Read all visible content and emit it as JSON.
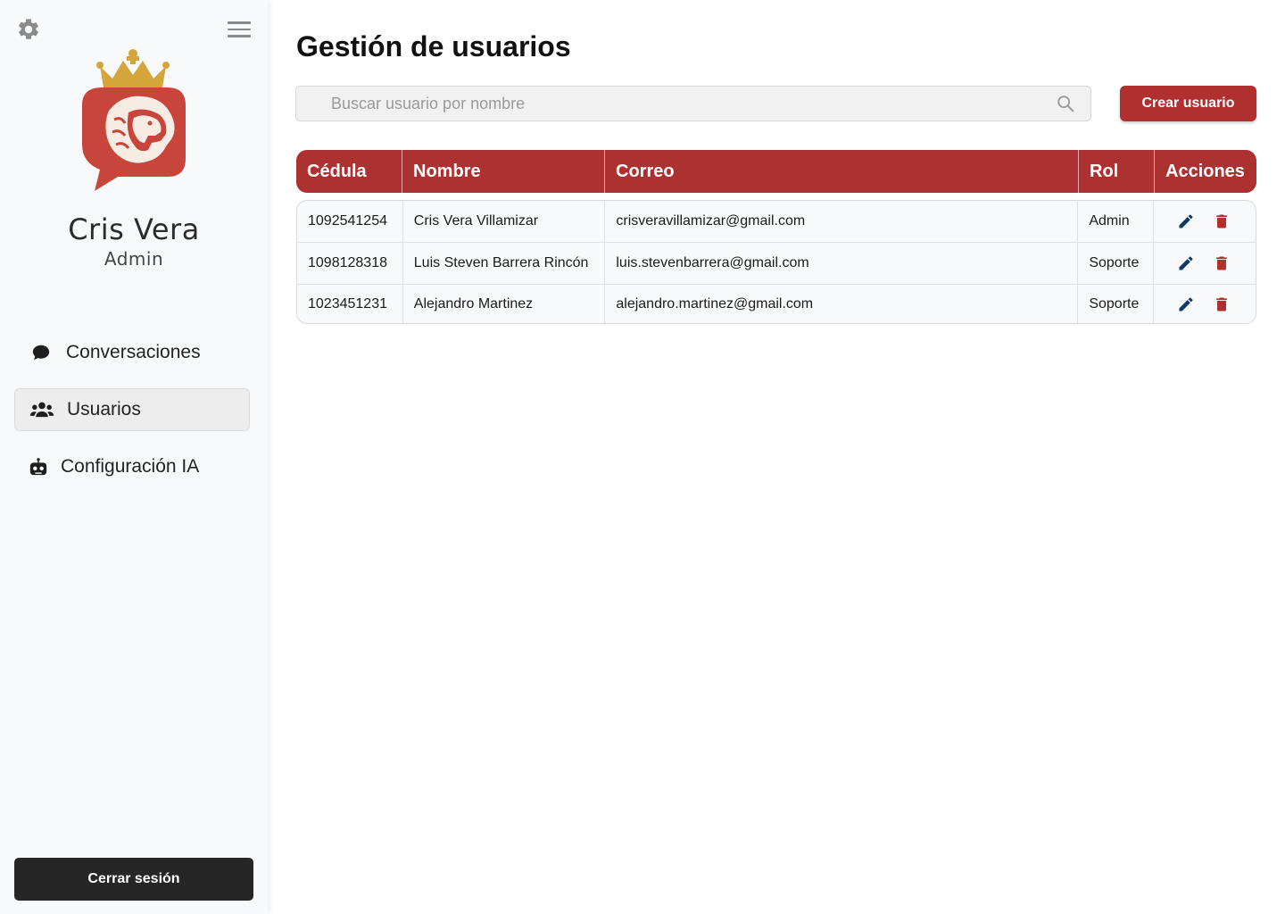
{
  "sidebar": {
    "user": {
      "name": "Cris Vera",
      "role": "Admin"
    },
    "nav": [
      {
        "label": "Conversaciones",
        "icon": "chat-bubble-icon"
      },
      {
        "label": "Usuarios",
        "icon": "users-icon",
        "active": true
      },
      {
        "label": "Configuración IA",
        "icon": "robot-icon"
      }
    ],
    "logout_label": "Cerrar sesión"
  },
  "main": {
    "title": "Gestión de usuarios",
    "search": {
      "placeholder": "Buscar usuario por nombre",
      "value": ""
    },
    "create_label": "Crear usuario",
    "table": {
      "headers": [
        "Cédula",
        "Nombre",
        "Correo",
        "Rol",
        "Acciones"
      ],
      "rows": [
        {
          "cedula": "1092541254",
          "nombre": "Cris Vera Villamizar",
          "correo": "crisveravillamizar@gmail.com",
          "rol": "Admin"
        },
        {
          "cedula": "1098128318",
          "nombre": "Luis Steven Barrera Rincón",
          "correo": "luis.stevenbarrera@gmail.com",
          "rol": "Soporte"
        },
        {
          "cedula": "1023451231",
          "nombre": "Alejandro Martinez",
          "correo": "alejandro.martinez@gmail.com",
          "rol": "Soporte"
        }
      ]
    }
  },
  "colors": {
    "brand_red": "#ad3131",
    "edit_blue": "#0b3a66",
    "delete_red": "#b02f2f",
    "crown_gold": "#d4a53a",
    "logout_dark": "#262626"
  }
}
